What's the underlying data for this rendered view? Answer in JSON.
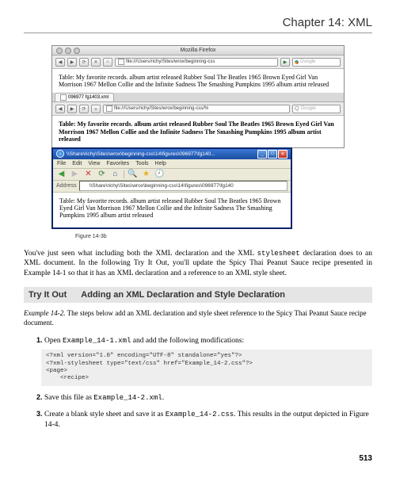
{
  "chapter": {
    "title": "Chapter 14: XML"
  },
  "firefox": {
    "title": "Mozilla Firefox",
    "url": "file:///Users/richy/Sites/wrox/beginning-css",
    "search_placeholder": "Google",
    "tab_label": "096977 fg1403.xml",
    "content": "Table: My favorite records. album artist released Rubber Soul The Beatles 1965 Brown Eyed Girl Van Morrison 1967 Mellon Collie and the Infinite Sadness The Smashing Pumpkins 1995 album artist released"
  },
  "safari": {
    "url": "file:///Users/richy/Sites/wrox/beginning-css/%",
    "search_placeholder": "Google",
    "content": "Table: My favorite records. album artist released Rubber Soul The Beatles 1965 Brown Eyed Girl Van Morrison 1967 Mellon Collie and the Infinite Sadness The Smashing Pumpkins 1995 album artist released"
  },
  "ie": {
    "title": "\\\\Share\\richy\\Sites\\wrox\\beginning-css\\14\\figures\\096977\\fg140...",
    "menu": {
      "file": "File",
      "edit": "Edit",
      "view": "View",
      "favorites": "Favorites",
      "tools": "Tools",
      "help": "Help"
    },
    "address_label": "Address",
    "url": "\\\\Share\\richy\\Sites\\wrox\\beginning-css\\14\\figures\\096977\\fg140",
    "content": "Table: My favorite records. album artist released Rubber Soul The Beatles 1965 Brown Eyed Girl Van Morrison 1967 Mellon Collie and the Infinite Sadness The Smashing Pumpkins 1995 album artist released"
  },
  "figure_caption": "Figure 14-3b",
  "body_para": "You've just seen what including both the XML declaration and the XML stylesheet declaration does to an XML document. In the following Try It Out, you'll update the Spicy Thai Peanut Sauce recipe presented in Example 14-1 so that it has an XML declaration and a reference to an XML style sheet.",
  "body_para_mono": "stylesheet",
  "tryit": {
    "label": "Try It Out",
    "heading": "Adding an XML Declaration and Style Declaration"
  },
  "example_para_prefix": "Example 14-2.",
  "example_para_rest": " The steps below add an XML declaration and style sheet reference to the Spicy Thai Peanut Sauce recipe document.",
  "steps": {
    "s1_pre": "Open ",
    "s1_code": "Example_14-1.xml",
    "s1_post": " and add the following modifications:",
    "code": "<?xml version=\"1.0\" encoding=\"UTF-8\" standalone=\"yes\"?>\n<?xml-stylesheet type=\"text/css\" href=\"Example_14-2.css\"?>\n<page>\n    <recipe>",
    "s2_pre": "Save this file as ",
    "s2_code": "Example_14-2.xml",
    "s2_post": ".",
    "s3_pre": "Create a blank style sheet and save it as ",
    "s3_code": "Example_14-2.css",
    "s3_post": ". This results in the output depicted in Figure 14-4."
  },
  "page_number": "513"
}
